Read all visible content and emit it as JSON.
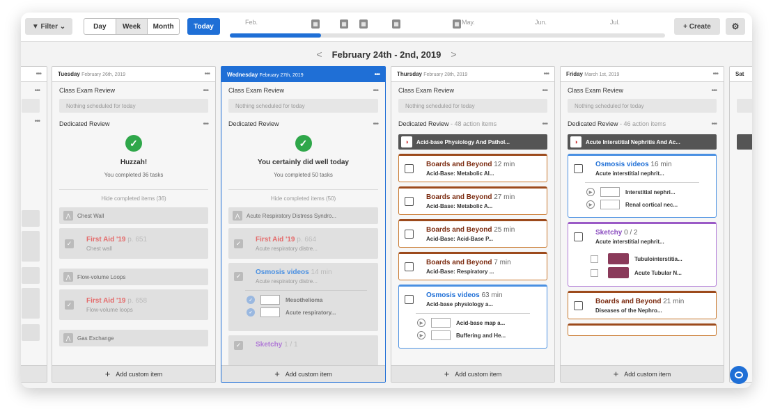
{
  "toolbar": {
    "filter": "Filter",
    "views": [
      "Day",
      "Week",
      "Month"
    ],
    "active_view": "Week",
    "today": "Today",
    "create": "+ Create",
    "settings_icon": "gear-icon"
  },
  "timeline": {
    "months": [
      "Feb.",
      "May.",
      "Jun.",
      "Jul."
    ],
    "progress": 0.21
  },
  "range": {
    "title": "February 24th - 2nd, 2019"
  },
  "sections": {
    "class_exam": "Class Exam Review",
    "dedicated": "Dedicated Review",
    "nothing": "Nothing scheduled for today",
    "add": "Add custom item",
    "hide_label": "Hide completed items"
  },
  "columns": {
    "tue": {
      "day": "Tuesday",
      "date": "February 26th, 2019",
      "huzzah": "Huzzah!",
      "completed": "You completed 36 tasks",
      "hide": "Hide completed items (36)",
      "groups": [
        "Chest Wall",
        "Flow-volume Loops",
        "Gas Exchange"
      ],
      "items": [
        {
          "src": "First Aid '19",
          "page": "p. 651",
          "topic": "Chest wall"
        },
        {
          "src": "First Aid '19",
          "page": "p. 658",
          "topic": "Flow-volume loops"
        }
      ]
    },
    "wed": {
      "day": "Wednesday",
      "date": "February 27th, 2019",
      "huzzah": "You certainly did well today",
      "completed": "You completed 50 tasks",
      "hide": "Hide completed items (50)",
      "groups": [
        "Acute Respiratory Distress Syndro..."
      ],
      "items": [
        {
          "src": "First Aid '19",
          "page": "p. 664",
          "topic": "Acute respiratory distre..."
        },
        {
          "src": "Osmosis videos",
          "page": "14 min",
          "topic": "Acute respiratory distre..."
        },
        {
          "src": "Sketchy",
          "page": "1 / 1"
        }
      ],
      "videos": [
        "Mesothelioma",
        "Acute respiratory..."
      ]
    },
    "thu": {
      "day": "Thursday",
      "date": "February 28th, 2019",
      "dedicated_suffix": " - 48 action items",
      "tag": "Acid-base Physiology And Pathol...",
      "cards": [
        {
          "src": "Boards and Beyond",
          "min": "12 min",
          "topic": "Acid-Base: Metabolic Al..."
        },
        {
          "src": "Boards and Beyond",
          "min": "27 min",
          "topic": "Acid-Base: Metabolic A..."
        },
        {
          "src": "Boards and Beyond",
          "min": "25 min",
          "topic": "Acid-Base: Acid-Base P..."
        },
        {
          "src": "Boards and Beyond",
          "min": "7 min",
          "topic": "Acid-Base: Respiratory ..."
        }
      ],
      "osmosis": {
        "src": "Osmosis videos",
        "min": "63 min",
        "topic": "Acid-base physiology a...",
        "videos": [
          "Acid-base map a...",
          "Buffering and He..."
        ]
      }
    },
    "fri": {
      "day": "Friday",
      "date": "March 1st, 2019",
      "dedicated_suffix": " - 46 action items",
      "tag": "Acute Interstitial Nephritis And Ac...",
      "osmosis": {
        "src": "Osmosis videos",
        "min": "16 min",
        "topic": "Acute interstitial nephrit...",
        "videos": [
          "Interstitial nephri...",
          "Renal cortical nec..."
        ]
      },
      "sketchy": {
        "src": "Sketchy",
        "count": "0 / 2",
        "topic": "Acute interstitial nephrit...",
        "subs": [
          "Tubulointerstitia...",
          "Acute Tubular N..."
        ]
      },
      "bb": {
        "src": "Boards and Beyond",
        "min": "21 min",
        "topic": "Diseases of the Nephro..."
      }
    },
    "sat": {
      "day": "Sat"
    }
  }
}
